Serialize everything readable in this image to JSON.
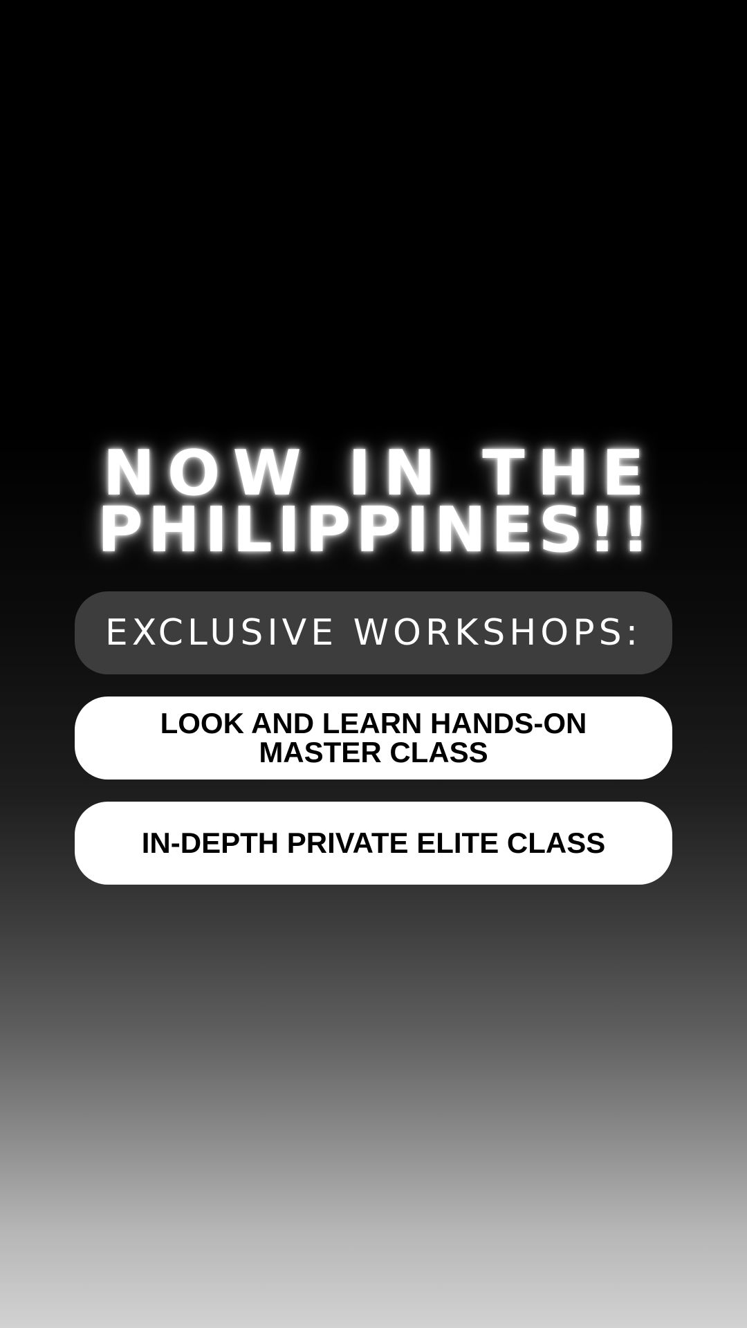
{
  "headline": {
    "line1": "NOW IN THE",
    "line2": "PHILIPPINES!!"
  },
  "workshops": {
    "heading": "EXCLUSIVE WORKSHOPS:",
    "items": [
      {
        "label": "LOOK AND LEARN HANDS-ON MASTER CLASS"
      },
      {
        "label": "IN-DEPTH PRIVATE ELITE CLASS"
      }
    ]
  },
  "colors": {
    "background_top": "#000000",
    "background_bottom": "#d2d2d2",
    "heading_pill": "#3d3d3d",
    "item_pill": "#ffffff",
    "headline_text": "#ffffff",
    "item_text": "#000000"
  }
}
